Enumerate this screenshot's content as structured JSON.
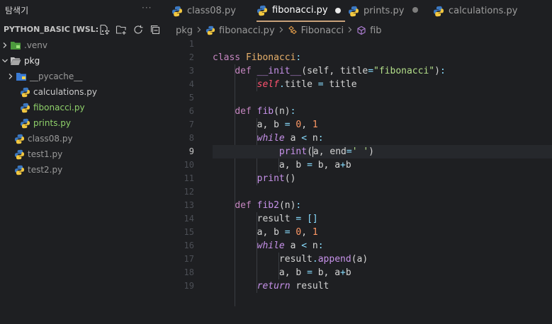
{
  "explorer": {
    "title": "탐색기",
    "more": "···",
    "section_label": "PYTHON_BASIC [WSL: ...",
    "actions": [
      "new-file-icon",
      "new-folder-icon",
      "refresh-icon",
      "collapse-all-icon"
    ],
    "items": [
      {
        "label": ".venv",
        "kind": "folder",
        "expanded": false,
        "depth": 0
      },
      {
        "label": "pkg",
        "kind": "folder",
        "expanded": true,
        "depth": 0
      },
      {
        "label": "__pycache__",
        "kind": "folder",
        "expanded": false,
        "depth": 1
      },
      {
        "label": "calculations.py",
        "kind": "python",
        "depth": 1
      },
      {
        "label": "fibonacci.py",
        "kind": "python",
        "depth": 1,
        "active": true
      },
      {
        "label": "prints.py",
        "kind": "python",
        "depth": 1
      },
      {
        "label": "class08.py",
        "kind": "python",
        "depth": 0
      },
      {
        "label": "test1.py",
        "kind": "python",
        "depth": 0
      },
      {
        "label": "test2.py",
        "kind": "python",
        "depth": 0
      }
    ]
  },
  "tabs": [
    {
      "label": "class08.py",
      "active": false
    },
    {
      "label": "fibonacci.py",
      "active": true,
      "modified": true
    },
    {
      "label": "prints.py",
      "active": false,
      "modified": true
    },
    {
      "label": "calculations.py",
      "active": false
    }
  ],
  "breadcrumb": {
    "folder": "pkg",
    "file": "fibonacci.py",
    "class": "Fibonacci",
    "method": "fib"
  },
  "editor": {
    "current_line": 9,
    "line_numbers": [
      "1",
      "2",
      "3",
      "4",
      "5",
      "6",
      "7",
      "8",
      "9",
      "10",
      "11",
      "12",
      "13",
      "14",
      "15",
      "16",
      "17",
      "18",
      "19"
    ],
    "lines": [
      "",
      "class Fibonacci:",
      "    def __init__(self, title=\"fibonacci\"):",
      "        self.title = title",
      "",
      "    def fib(n):",
      "        a, b = 0, 1",
      "        while a < n:",
      "            print(a, end=' ')",
      "            a, b = b, a+b",
      "        print()",
      "",
      "    def fib2(n):",
      "        result = []",
      "        a, b = 0, 1",
      "        while a < n:",
      "            result.append(a)",
      "            a, b = b, a+b",
      "        return result"
    ]
  },
  "colors": {
    "background": "#1e1f22",
    "active_file": "#8fd16a",
    "keyword": "#c792ea",
    "class_name": "#e8b16b",
    "string": "#b4df8a",
    "number": "#ff9966",
    "tab_underline": "#c9a27a"
  }
}
